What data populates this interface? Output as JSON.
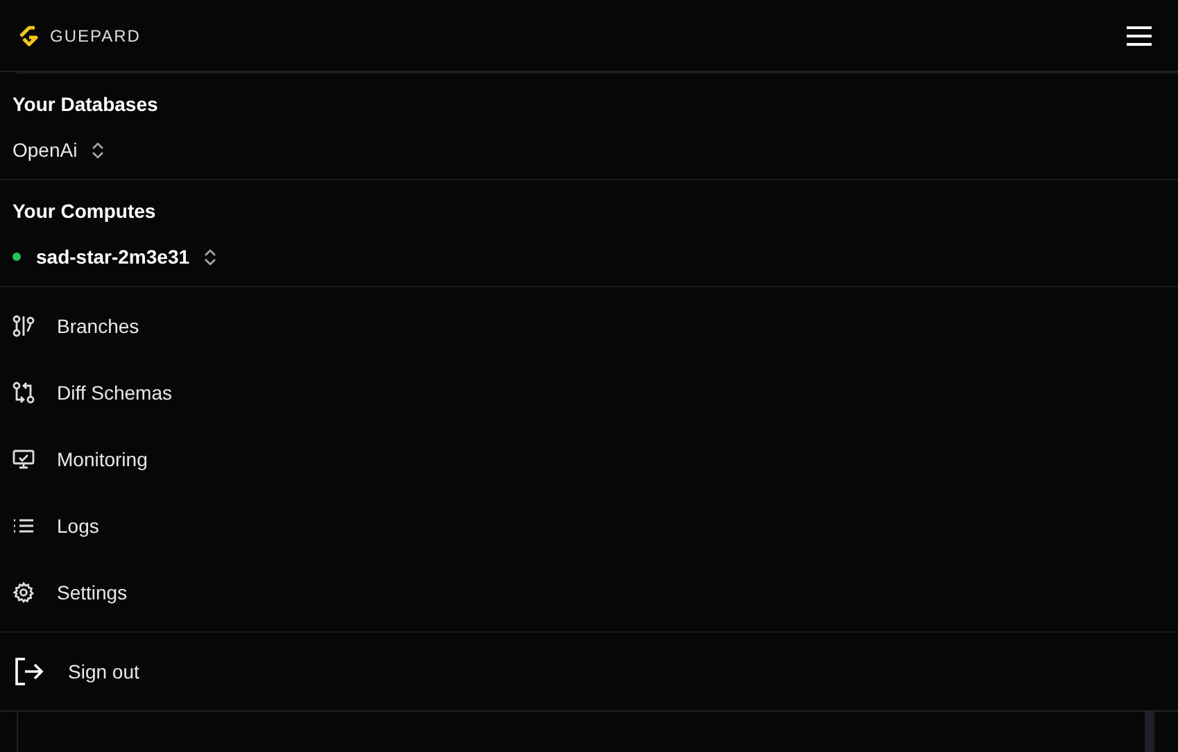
{
  "header": {
    "logo_text": "GUEPARD"
  },
  "databases": {
    "title": "Your Databases",
    "current": "OpenAi"
  },
  "computes": {
    "title": "Your Computes",
    "current": "sad-star-2m3e31",
    "color": "#22c55e"
  },
  "nav": [
    {
      "kind": "branches",
      "label": "Branches"
    },
    {
      "kind": "diff",
      "label": "Diff Schemas"
    },
    {
      "kind": "monitor",
      "label": "Monitoring"
    },
    {
      "kind": "logs",
      "label": "Logs"
    },
    {
      "kind": "settings",
      "label": "Settings"
    }
  ],
  "sign_out": {
    "label": "Sign out"
  }
}
